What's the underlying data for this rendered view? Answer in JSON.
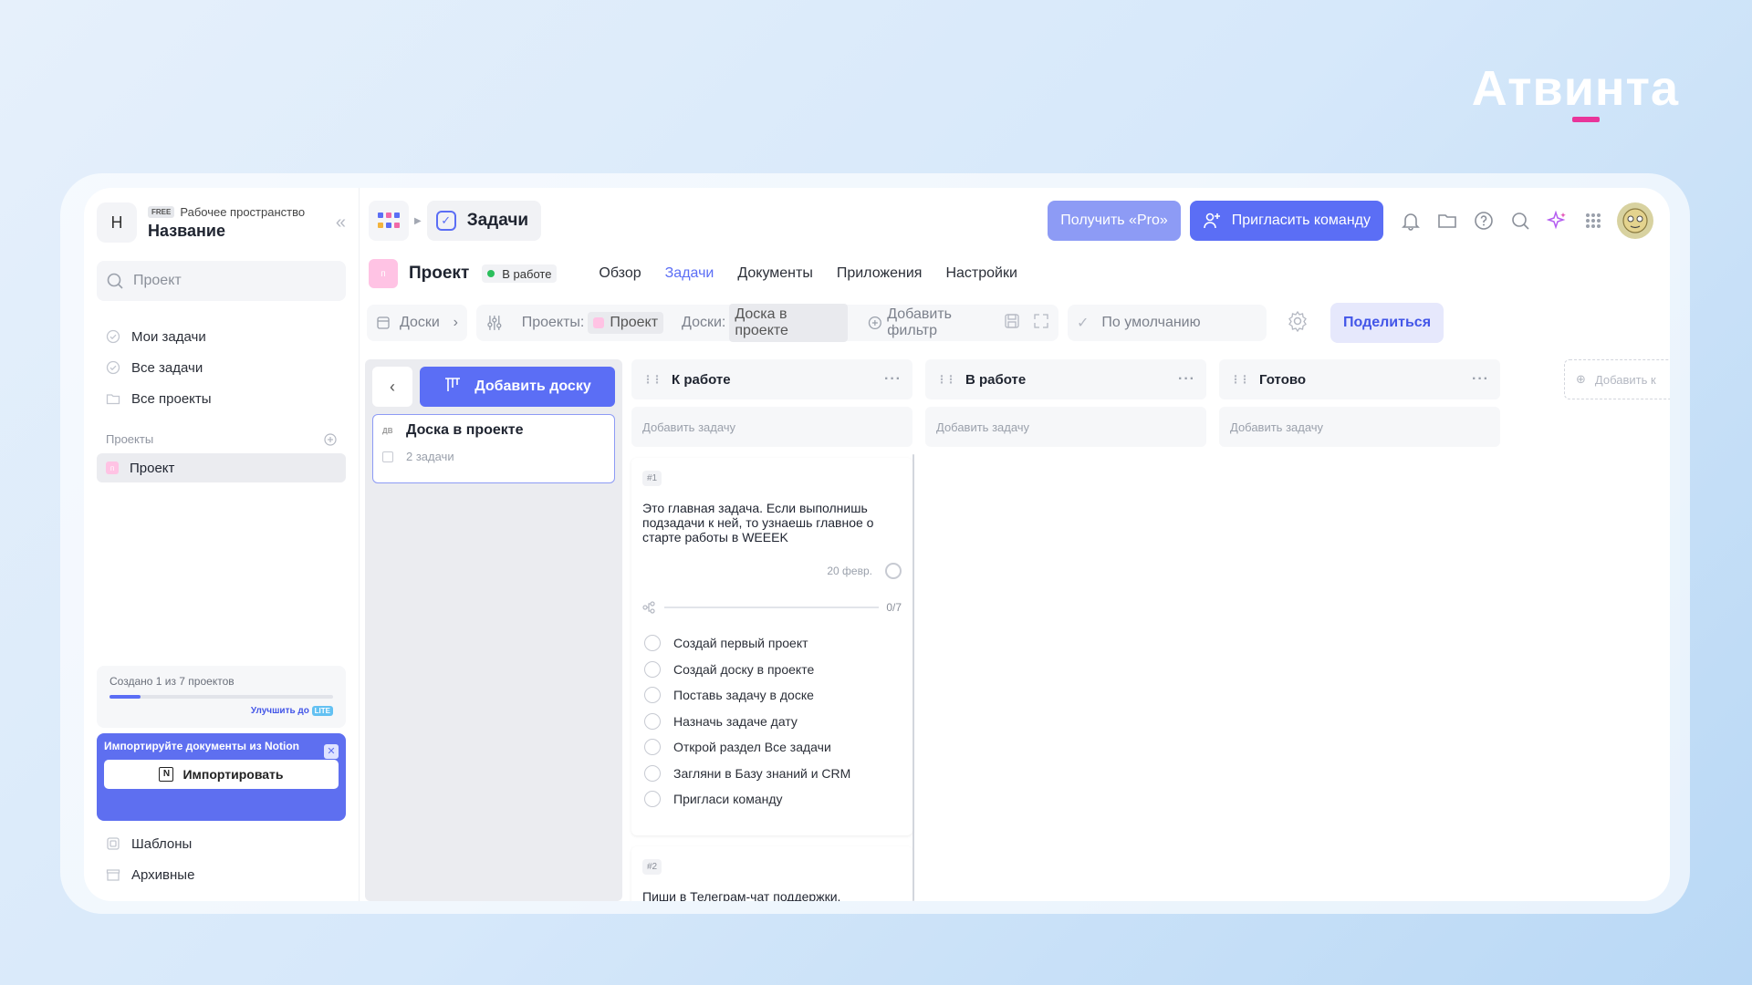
{
  "brand": "Атвинта",
  "sidebar": {
    "avatar_letter": "Н",
    "workspace_badge": "FREE",
    "workspace_label": "Рабочее пространство",
    "workspace_name": "Название",
    "search_placeholder": "Проект",
    "nav": [
      {
        "label": "Мои задачи",
        "icon": "check-circle-icon"
      },
      {
        "label": "Все задачи",
        "icon": "check-circle-icon"
      },
      {
        "label": "Все проекты",
        "icon": "folder-icon"
      }
    ],
    "projects_header": "Проекты",
    "project_item": "Проект",
    "project_item_initial": "п",
    "limit_text": "Создано 1 из 7 проектов",
    "limit_progress": 0.14,
    "upgrade_text": "Улучшить до",
    "upgrade_badge": "LITE",
    "import_title": "Импортируйте документы из Notion",
    "import_button": "Импортировать",
    "bottom_nav": [
      {
        "label": "Шаблоны",
        "icon": "templates-icon"
      },
      {
        "label": "Архивные",
        "icon": "archive-icon"
      }
    ]
  },
  "topbar": {
    "page_title": "Задачи",
    "pro_button": "Получить «Pro»",
    "invite_button": "Пригласить команду"
  },
  "project": {
    "initial": "п",
    "name": "Проект",
    "status": "В работе",
    "tabs": [
      "Обзор",
      "Задачи",
      "Документы",
      "Приложения",
      "Настройки"
    ],
    "active_tab": "Задачи"
  },
  "filters": {
    "boards_label": "Доски",
    "projects_key": "Проекты:",
    "projects_value": "Проект",
    "boards_key": "Доски:",
    "boards_value": "Доска в проекте",
    "add_filter": "Добавить фильтр",
    "sort_default": "По умолчанию",
    "share": "Поделиться"
  },
  "boards_panel": {
    "add_board": "Добавить доску",
    "board_name": "Доска в проекте",
    "board_tag": "ДВ",
    "board_tasks": "2 задачи"
  },
  "columns": [
    {
      "title": "К работе",
      "add_task": "Добавить задачу"
    },
    {
      "title": "В работе",
      "add_task": "Добавить задачу"
    },
    {
      "title": "Готово",
      "add_task": "Добавить задачу"
    }
  ],
  "ghost_column": "Добавить к",
  "tasks": [
    {
      "num": "#1",
      "text": "Это главная задача. Если выполнишь подзадачи к ней, то узнаешь главное о старте работы в WEEEK",
      "date": "20 февр.",
      "progress": "0/7",
      "subtasks": [
        "Создай первый проект",
        "Создай доску в проекте",
        "Поставь задачу в доске",
        "Назначь задаче дату",
        "Открой раздел Все задачи",
        "Загляни в Базу знаний и CRM",
        "Пригласи команду"
      ]
    },
    {
      "num": "#2",
      "text": "Пиши в Телеграм-чат поддержки,"
    }
  ],
  "colors": {
    "accent": "#5b6ef5",
    "pro": "#8d9bf5",
    "status_green": "#2bbf5c",
    "project_pink": "#ffc3e4"
  }
}
